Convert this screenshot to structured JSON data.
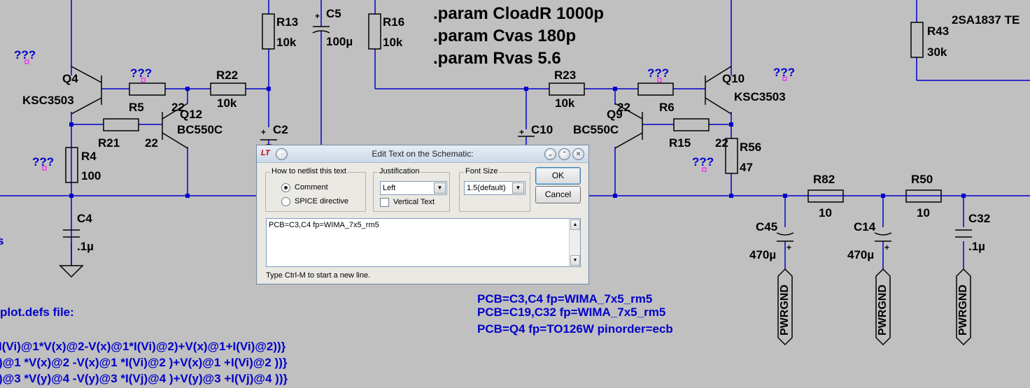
{
  "schematic": {
    "params": [
      ".param CloadR 1000p",
      ".param Cvas 180p",
      ".param Rvas 5.6"
    ],
    "unknown_marker": "???",
    "labels": {
      "r13": "R13",
      "r13v": "10k",
      "c5": "C5",
      "c5v": "100µ",
      "r16": "R16",
      "r16v": "10k",
      "r43": "R43",
      "r43v": "30k",
      "q_2sa": "2SA1837 TE",
      "q4": "Q4",
      "q4t": "KSC3503",
      "r5": "R5",
      "r5v": "22",
      "q12": "Q12",
      "q12t": "BC550C",
      "r22": "R22",
      "r22v": "10k",
      "c2": "C2",
      "r21": "R21",
      "r21v": "22",
      "r4": "R4",
      "r4v": "100",
      "c4": "C4",
      "c4v": ".1µ",
      "r23": "R23",
      "r23v": "10k",
      "c10": "C10",
      "q9": "Q9",
      "q9t": "BC550C",
      "r6": "R6",
      "r6v": "22",
      "q10": "Q10",
      "q10t": "KSC3503",
      "r15": "R15",
      "r15v": "22",
      "r56": "R56",
      "r56v": "47",
      "r82": "R82",
      "r82v": "10",
      "r50": "R50",
      "r50v": "10",
      "c45": "C45",
      "c45v": "470µ",
      "c14": "C14",
      "c14v": "470µ",
      "c32": "C32",
      "c32v": ".1µ",
      "pwrgnd": "PWRGND",
      "plus": "+"
    },
    "comments": {
      "pcb1": "PCB=C3,C4 fp=WIMA_7x5_rm5",
      "pcb2": "PCB=C19,C32 fp=WIMA_7x5_rm5",
      "pcb3": "PCB=Q4 fp=TO126W pinorder=ecb",
      "plotdefs": "plot.defs file:",
      "f1": "I(Vi)@1*V(x)@2-V(x)@1*I(Vi)@2)+V(x)@1+I(Vi)@2))}",
      "f2": ")@1  *V(x)@2  -V(x)@1  *I(Vi)@2  )+V(x)@1  +I(Vi)@2  ))}",
      "f3": ")@3  *V(y)@4  -V(y)@3  *I(Vj)@4  )+V(y)@3  +I(Vj)@4  ))}",
      "edge": "s"
    }
  },
  "dialog": {
    "title": "Edit Text on the Schematic:",
    "logo": "LT",
    "netlist_group": "How to netlist this text",
    "radio_comment": "Comment",
    "radio_spice": "SPICE directive",
    "radio_selected": "Comment",
    "justification_group": "Justification",
    "justification_value": "Left",
    "vertical_text": "Vertical Text",
    "vertical_checked": false,
    "font_group": "Font Size",
    "font_value": "1.5(default)",
    "ok": "OK",
    "cancel": "Cancel",
    "text_value": "PCB=C3,C4 fp=WIMA_7x5_rm5",
    "hint": "Type Ctrl-M to start a new line."
  },
  "colors": {
    "wire": "#0000cc",
    "component": "#000000",
    "background": "#c0c0c0",
    "unknown_marker": "#0000cc",
    "pin_marker": "#ff00ff"
  }
}
